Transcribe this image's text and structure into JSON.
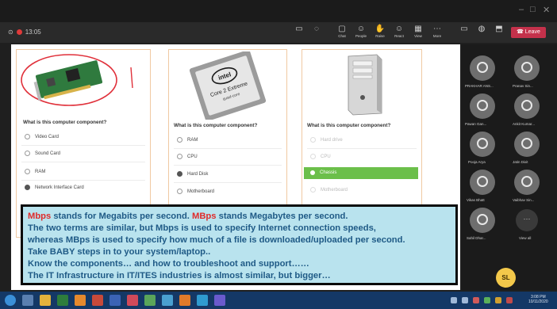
{
  "toolbar": {
    "recording_time": "13:05",
    "tools": [
      "Chat",
      "People",
      "Raise",
      "React",
      "View",
      "More"
    ],
    "leave_label": "Leave"
  },
  "slide": {
    "cards": [
      {
        "question": "What is this computer component?",
        "options": [
          "Video Card",
          "Sound Card",
          "RAM",
          "Network Interface Card"
        ],
        "selected": 3
      },
      {
        "question": "What is this computer component?",
        "chip_brand": "intel",
        "chip_text": "Core 2 Extreme",
        "chip_sub": "quad-core",
        "options": [
          "RAM",
          "CPU",
          "Hard Disk",
          "Motherboard"
        ],
        "selected": 2
      },
      {
        "question": "What is this computer component?",
        "options": [
          "Hard drive",
          "CPU",
          "Chassis",
          "Motherboard"
        ],
        "selected": 2
      }
    ],
    "note": {
      "line1_a": "Mbps",
      "line1_b": " stands for Megabits per second. ",
      "line1_c": "MBps",
      "line1_d": " stands Megabytes per second.",
      "line2": "The two terms are similar, but Mbps is used to specify Internet connection speeds,",
      "line3": "whereas MBps is used to specify how much of a file is downloaded/uploaded per second.",
      "line4": "Take BABY steps in to your system/laptop..",
      "line5": "Know the components… and how to troubleshoot and support……",
      "line6": "The IT Infrastructure in IT/ITES industries is almost similar, but bigger…"
    }
  },
  "participants": {
    "people": [
      {
        "name": "PRAKHAR ANS..."
      },
      {
        "name": "Pranav Sin..."
      },
      {
        "name": "Pawan Gan..."
      },
      {
        "name": "Ankit Kumar..."
      },
      {
        "name": "Pooja Arya"
      },
      {
        "name": "Jatin Dixit"
      },
      {
        "name": "Vikas Bhatt"
      },
      {
        "name": "Vaibhav Sin..."
      },
      {
        "name": "Sahil Dhar..."
      }
    ],
    "view_all_label": "View all",
    "self_initials": "SL"
  },
  "taskbar": {
    "time": "3:08 PM",
    "date": "10/11/2020"
  },
  "colors": {
    "note_bg": "#b9e3ee",
    "note_text": "#1f5a86",
    "highlight_red": "#e02a2a",
    "selected_green": "#6bbf4a",
    "leave_red": "#c4314b"
  }
}
